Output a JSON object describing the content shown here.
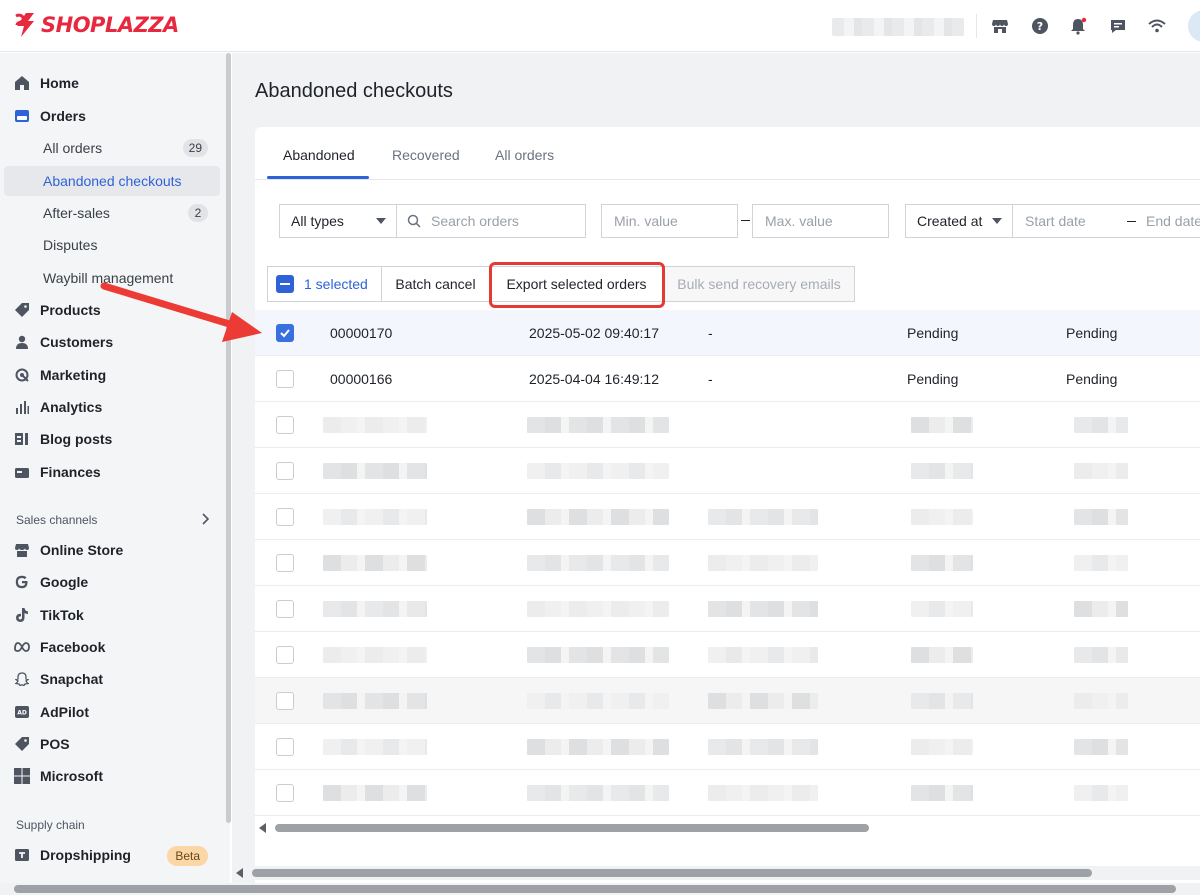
{
  "brand": {
    "name": "SHOPLAZZA",
    "color": "#e8283e"
  },
  "topbar": {
    "icons": [
      "store-icon",
      "help-icon",
      "bell-icon",
      "chat-icon",
      "wifi-icon"
    ]
  },
  "sidebar": {
    "items": [
      {
        "label": "Home",
        "icon": "home-icon"
      },
      {
        "label": "Orders",
        "icon": "orders-icon"
      },
      {
        "label": "All orders",
        "badge": "29"
      },
      {
        "label": "Abandoned checkouts"
      },
      {
        "label": "After-sales",
        "badge": "2"
      },
      {
        "label": "Disputes"
      },
      {
        "label": "Waybill management"
      },
      {
        "label": "Products",
        "icon": "tag-icon"
      },
      {
        "label": "Customers",
        "icon": "person-icon"
      },
      {
        "label": "Marketing",
        "icon": "marketing-icon"
      },
      {
        "label": "Analytics",
        "icon": "bar-chart-icon"
      },
      {
        "label": "Blog posts",
        "icon": "blog-icon"
      },
      {
        "label": "Finances",
        "icon": "finances-icon"
      }
    ],
    "sales_channels_label": "Sales channels",
    "channels": [
      {
        "label": "Online Store",
        "icon": "store-icon"
      },
      {
        "label": "Google",
        "icon": "google-icon"
      },
      {
        "label": "TikTok",
        "icon": "tiktok-icon"
      },
      {
        "label": "Facebook",
        "icon": "meta-icon"
      },
      {
        "label": "Snapchat",
        "icon": "snapchat-icon"
      },
      {
        "label": "AdPilot",
        "icon": "ad-icon"
      },
      {
        "label": "POS",
        "icon": "pos-tag-icon"
      },
      {
        "label": "Microsoft",
        "icon": "microsoft-icon"
      }
    ],
    "supply_chain_label": "Supply chain",
    "supply": [
      {
        "label": "Dropshipping",
        "icon": "dropshipping-icon",
        "badge": "Beta"
      }
    ]
  },
  "page": {
    "title": "Abandoned checkouts",
    "tabs": [
      "Abandoned",
      "Recovered",
      "All orders"
    ],
    "active_tab": "Abandoned",
    "filters": {
      "type_select": "All types",
      "search_placeholder": "Search orders",
      "min_placeholder": "Min. value",
      "max_placeholder": "Max. value",
      "date_select": "Created at",
      "start_placeholder": "Start date",
      "end_placeholder": "End date"
    },
    "batch": {
      "selected_label": "1 selected",
      "batch_cancel": "Batch cancel",
      "export_selected": "Export selected orders",
      "bulk_send": "Bulk send recovery emails"
    },
    "rows": [
      {
        "id": "00000170",
        "date": "2025-05-02 09:40:17",
        "contact": "-",
        "status1": "Pending",
        "status2": "Pending",
        "checked": true
      },
      {
        "id": "00000166",
        "date": "2025-04-04 16:49:12",
        "contact": "-",
        "status1": "Pending",
        "status2": "Pending",
        "checked": false
      }
    ],
    "blurred_row_count": 9
  },
  "colors": {
    "accent": "#2f62d8",
    "highlight": "#e53935",
    "arrow": "#ec3a35"
  }
}
